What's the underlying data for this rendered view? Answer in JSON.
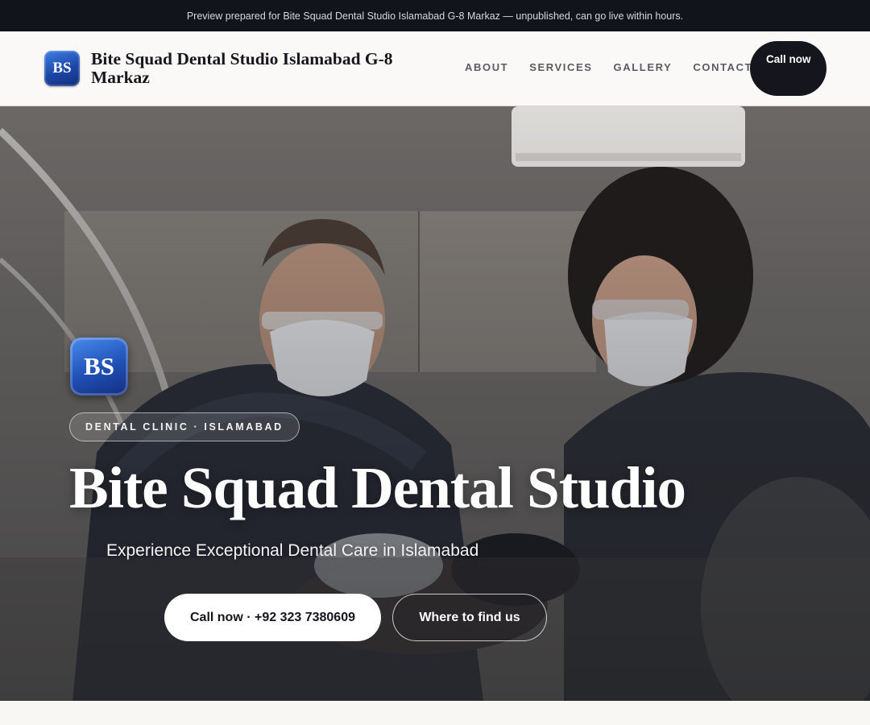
{
  "preview_bar": {
    "text": "Preview prepared for Bite Squad Dental Studio Islamabad G-8 Markaz — unpublished, can go live within hours."
  },
  "header": {
    "logo_text": "BS",
    "brand_name": "Bite Squad Dental Studio Islamabad G-8 Markaz",
    "nav": [
      {
        "label": "ABOUT"
      },
      {
        "label": "SERVICES"
      },
      {
        "label": "GALLERY"
      },
      {
        "label": "CONTACT"
      }
    ],
    "call_label": "Call now"
  },
  "hero": {
    "logo_text": "BS",
    "badge": "DENTAL CLINIC · ISLAMABAD",
    "title": "Bite Squad Dental Studio",
    "subtitle": "Experience Exceptional Dental Care in Islamabad",
    "primary_button": "Call now · +92 323 7380609",
    "secondary_button": "Where to find us",
    "photo_icon": "dentist-treatment-photo"
  },
  "colors": {
    "preview_bar_bg": "#12141b",
    "header_bg": "#faf9f7",
    "call_button_bg": "#15161d",
    "logo_blue": "#1c47a8",
    "hero_text": "#ffffff"
  }
}
